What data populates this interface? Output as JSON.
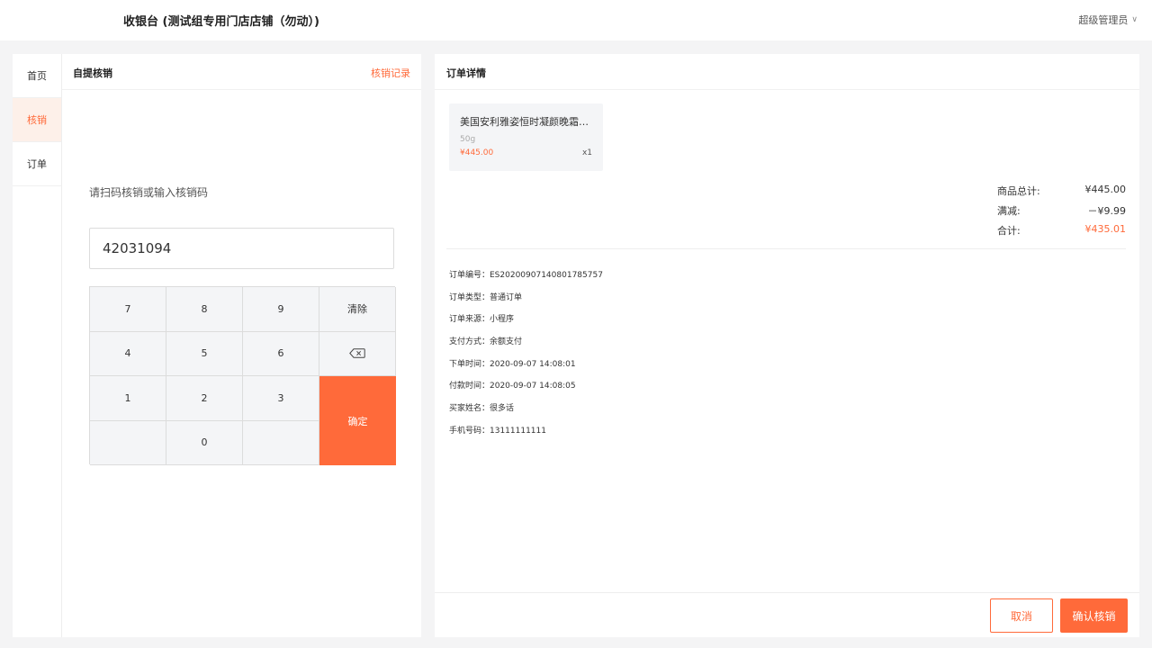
{
  "header": {
    "title": "收银台 (测试组专用门店店铺（勿动）)",
    "user": "超级管理员",
    "user_icon": "chevron-down-icon"
  },
  "sidebar": {
    "items": [
      {
        "label": "首页",
        "active": false
      },
      {
        "label": "核销",
        "active": true
      },
      {
        "label": "订单",
        "active": false
      }
    ]
  },
  "verify": {
    "title": "自提核销",
    "records_link": "核销记录",
    "prompt": "请扫码核销或输入核销码",
    "input_value": "42031094",
    "keypad": {
      "k7": "7",
      "k8": "8",
      "k9": "9",
      "clear": "清除",
      "k4": "4",
      "k5": "5",
      "k6": "6",
      "backspace_icon": "backspace-icon",
      "k1": "1",
      "k2": "2",
      "k3": "3",
      "confirm": "确定",
      "k0": "0"
    }
  },
  "order": {
    "title": "订单详情",
    "product": {
      "name": "美国安利雅姿恒时凝颜晚霜…",
      "spec": "50g",
      "price": "¥445.00",
      "qty": "x1"
    },
    "totals": [
      {
        "label": "商品总计:",
        "value": "¥445.00"
      },
      {
        "label": "满减:",
        "value": "－¥9.99"
      },
      {
        "label": "合计:",
        "value": "¥435.01"
      }
    ],
    "info": [
      "订单编号：ES20200907140801785757",
      "订单类型：普通订单",
      "订单来源：小程序",
      "支付方式：余额支付",
      "下单时间：2020-09-07 14:08:01",
      "付款时间：2020-09-07 14:08:05",
      "买家姓名：很多话",
      "手机号码：13111111111"
    ],
    "cancel": "取消",
    "confirm": "确认核销"
  },
  "colors": {
    "accent": "#ff6a3a",
    "active_bg": "#fdf0e9"
  }
}
